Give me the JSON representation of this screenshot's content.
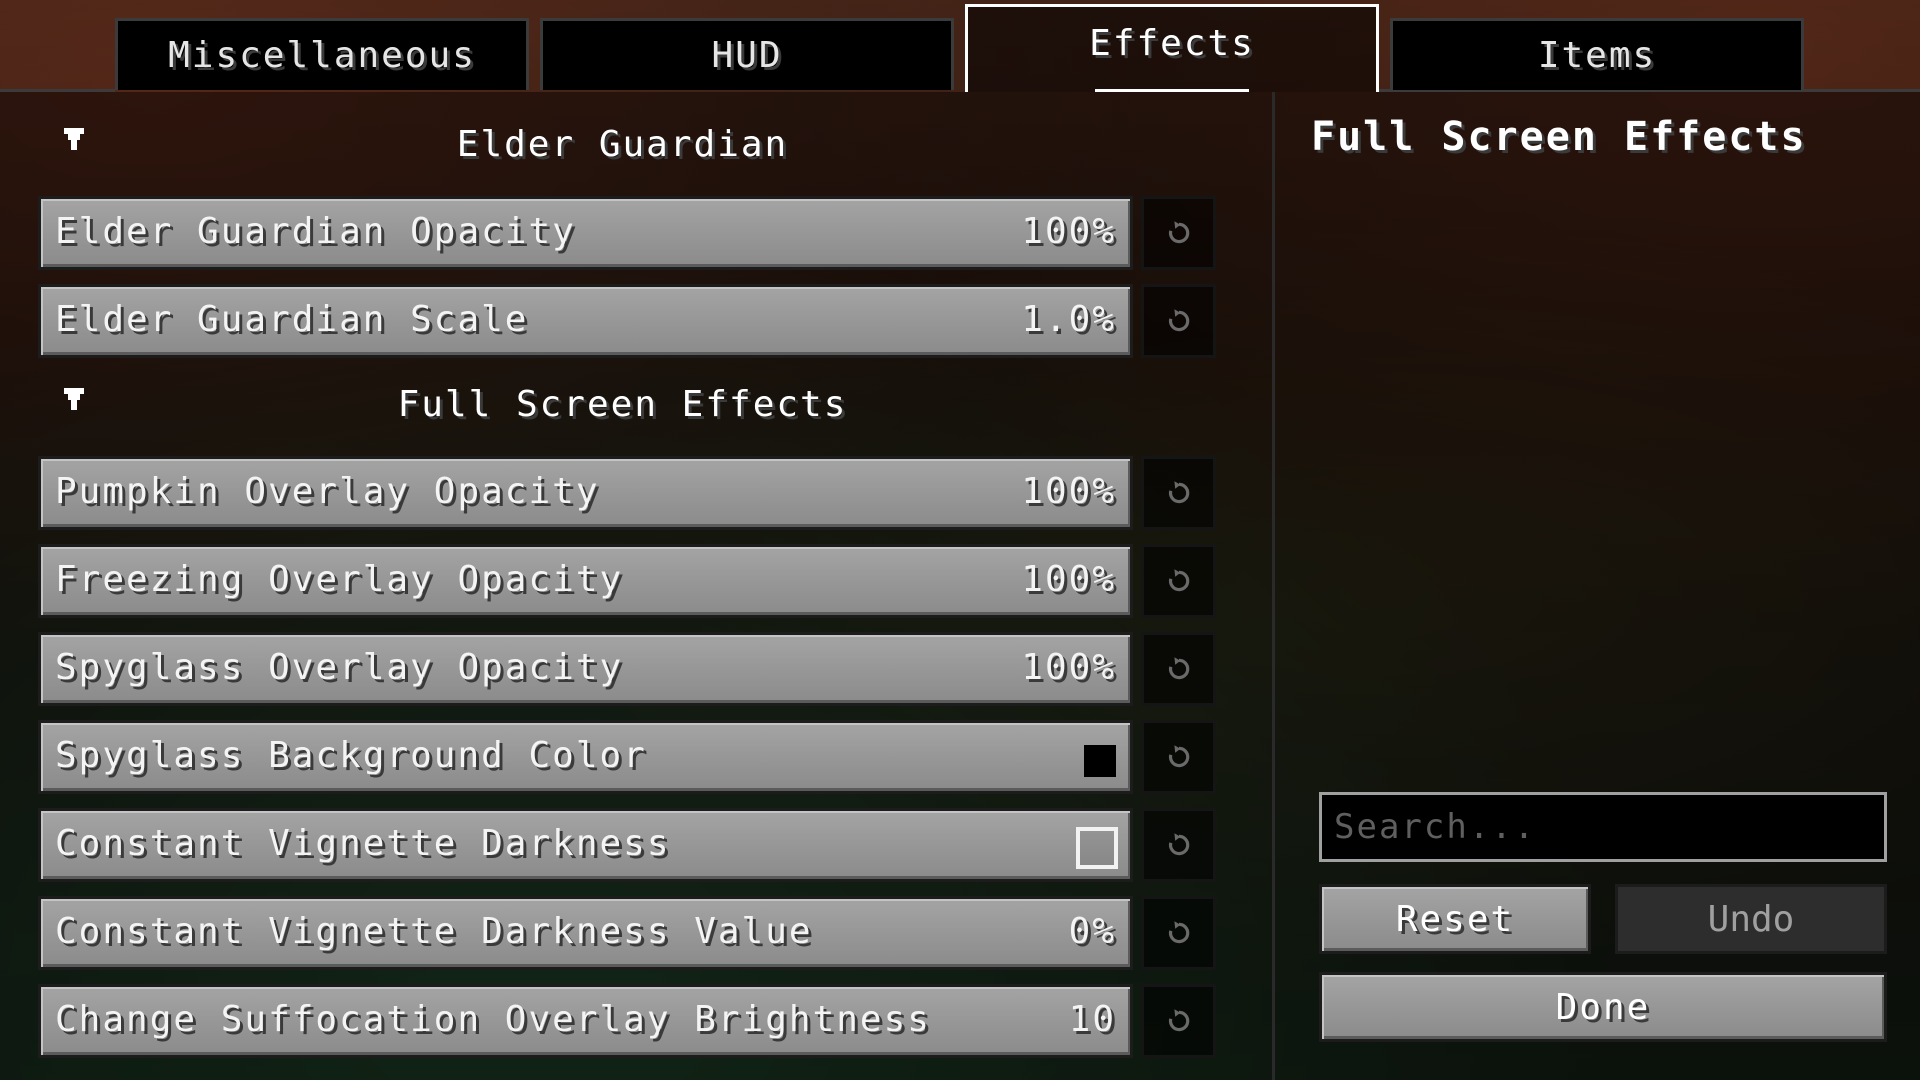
{
  "tabs": [
    {
      "label": "Miscellaneous",
      "active": false
    },
    {
      "label": "HUD",
      "active": false
    },
    {
      "label": "Effects",
      "active": true
    },
    {
      "label": "Items",
      "active": false
    }
  ],
  "sections": [
    {
      "title": "Elder Guardian",
      "options": [
        {
          "label": "Elder Guardian Opacity",
          "type": "slider",
          "value": "100%"
        },
        {
          "label": "Elder Guardian Scale",
          "type": "slider",
          "value": "1.0%"
        }
      ]
    },
    {
      "title": "Full Screen Effects",
      "options": [
        {
          "label": "Pumpkin Overlay Opacity",
          "type": "slider",
          "value": "100%"
        },
        {
          "label": "Freezing Overlay Opacity",
          "type": "slider",
          "value": "100%"
        },
        {
          "label": "Spyglass Overlay Opacity",
          "type": "slider",
          "value": "100%"
        },
        {
          "label": "Spyglass Background Color",
          "type": "color",
          "color": "#000000"
        },
        {
          "label": "Constant Vignette Darkness",
          "type": "toggle",
          "checked": false
        },
        {
          "label": "Constant Vignette Darkness Value",
          "type": "slider",
          "value": "0%"
        },
        {
          "label": "Change Suffocation Overlay Brightness",
          "type": "slider",
          "value": "10"
        }
      ]
    }
  ],
  "sidebar": {
    "title": "Full Screen Effects",
    "search_placeholder": "Search...",
    "reset_label": "Reset",
    "undo_label": "Undo",
    "done_label": "Done"
  },
  "icons": {
    "reset_option": "reset-arrow-icon",
    "collapse": "collapse-arrow-icon"
  }
}
